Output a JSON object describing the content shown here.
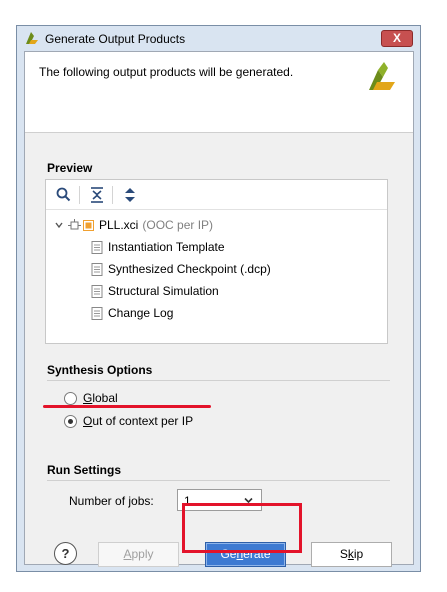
{
  "window": {
    "title": "Generate Output Products",
    "close_label": "X"
  },
  "banner": {
    "description": "The following output products will be generated."
  },
  "preview": {
    "section_title": "Preview",
    "toolbar": [
      "search-icon",
      "collapse-all-icon",
      "expand-all-icon"
    ],
    "root": {
      "name": "PLL.xci",
      "note": "(OOC per IP)"
    },
    "children": [
      "Instantiation Template",
      "Synthesized Checkpoint (.dcp)",
      "Structural Simulation",
      "Change Log"
    ]
  },
  "synthesis": {
    "section_title": "Synthesis Options",
    "options": [
      {
        "label": "Global",
        "mnemonic": "G",
        "rest": "lobal",
        "checked": false
      },
      {
        "label": "Out of context per IP",
        "mnemonic": "O",
        "rest": "ut of context per IP",
        "checked": true
      }
    ]
  },
  "run": {
    "section_title": "Run Settings",
    "jobs_label_pre": "Number of ",
    "jobs_label_mn": "j",
    "jobs_label_post": "obs:",
    "jobs_value": "1"
  },
  "buttons": {
    "help": "?",
    "apply_pre": "",
    "apply_mn": "A",
    "apply_post": "pply",
    "generate_pre": "Ge",
    "generate_mn": "n",
    "generate_post": "erate",
    "skip_pre": "S",
    "skip_mn": "k",
    "skip_post": "ip"
  },
  "colors": {
    "accent": "#3d7ad2",
    "annotation": "#e3132a",
    "ooc_box": "#f0a030"
  }
}
